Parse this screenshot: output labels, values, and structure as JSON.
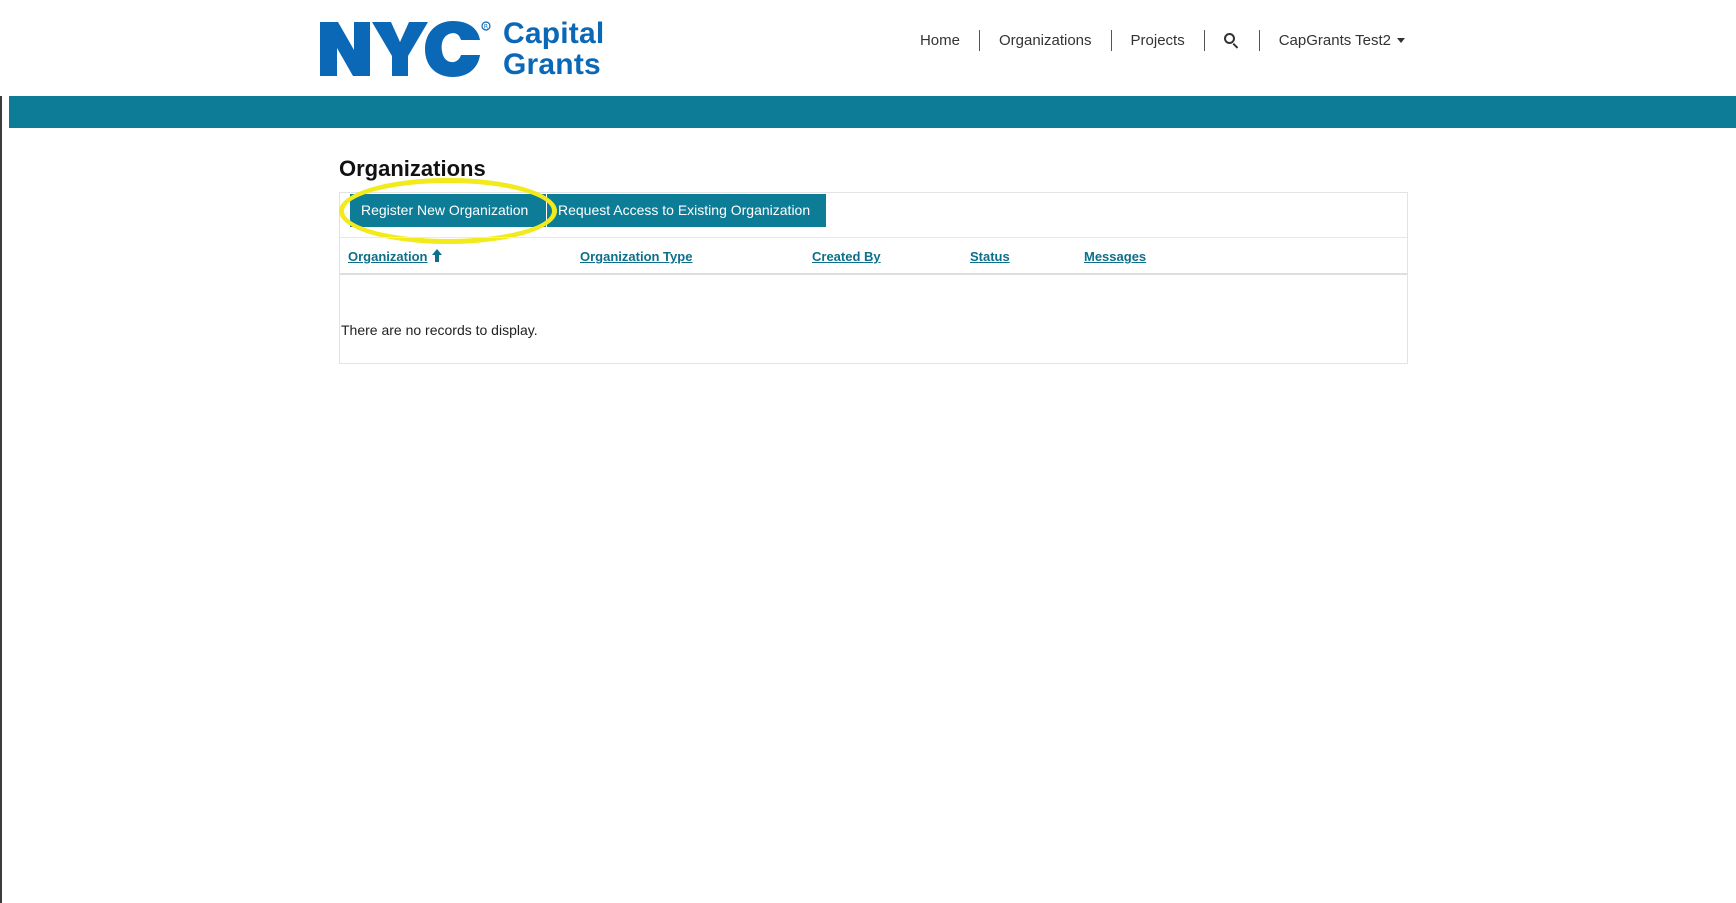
{
  "logo": {
    "nyc_text": "NYC",
    "line1": "Capital",
    "line2": "Grants"
  },
  "nav": {
    "home": "Home",
    "organizations": "Organizations",
    "projects": "Projects",
    "search_icon": "search-icon",
    "user": "CapGrants Test2"
  },
  "page": {
    "title": "Organizations"
  },
  "actions": {
    "register": "Register New Organization",
    "request_access": "Request Access to Existing Organization"
  },
  "table": {
    "columns": [
      "Organization",
      "Organization Type",
      "Created By",
      "Status",
      "Messages"
    ],
    "sorted_column": "Organization",
    "sort_direction": "ascending",
    "empty_message": "There are no records to display."
  },
  "colors": {
    "brand_teal": "#0d7c96",
    "logo_blue": "#0a68b7",
    "highlight": "#f2ea1a"
  }
}
